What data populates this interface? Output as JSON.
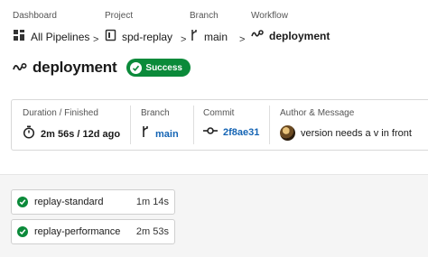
{
  "breadcrumb": {
    "dashboard": {
      "caption": "Dashboard",
      "value": "All Pipelines",
      "icon": "pipelines-grid-icon"
    },
    "project": {
      "caption": "Project",
      "value": "spd-replay",
      "icon": "project-icon"
    },
    "branch": {
      "caption": "Branch",
      "value": "main",
      "icon": "branch-icon"
    },
    "workflow": {
      "caption": "Workflow",
      "value": "deployment",
      "icon": "workflow-icon"
    },
    "separator": ">"
  },
  "header": {
    "title": "deployment",
    "status": "Success",
    "status_color": "#0b8a3a"
  },
  "summary": {
    "duration": {
      "caption": "Duration / Finished",
      "value": "2m 56s / 12d ago"
    },
    "branch": {
      "caption": "Branch",
      "value": "main"
    },
    "commit": {
      "caption": "Commit",
      "value": "2f8ae31"
    },
    "author": {
      "caption": "Author & Message",
      "value": "version needs a v in front"
    },
    "link_color": "#1464b4"
  },
  "jobs": [
    {
      "name": "replay-standard",
      "duration": "1m 14s",
      "status": "success"
    },
    {
      "name": "replay-performance",
      "duration": "2m 53s",
      "status": "success"
    }
  ]
}
